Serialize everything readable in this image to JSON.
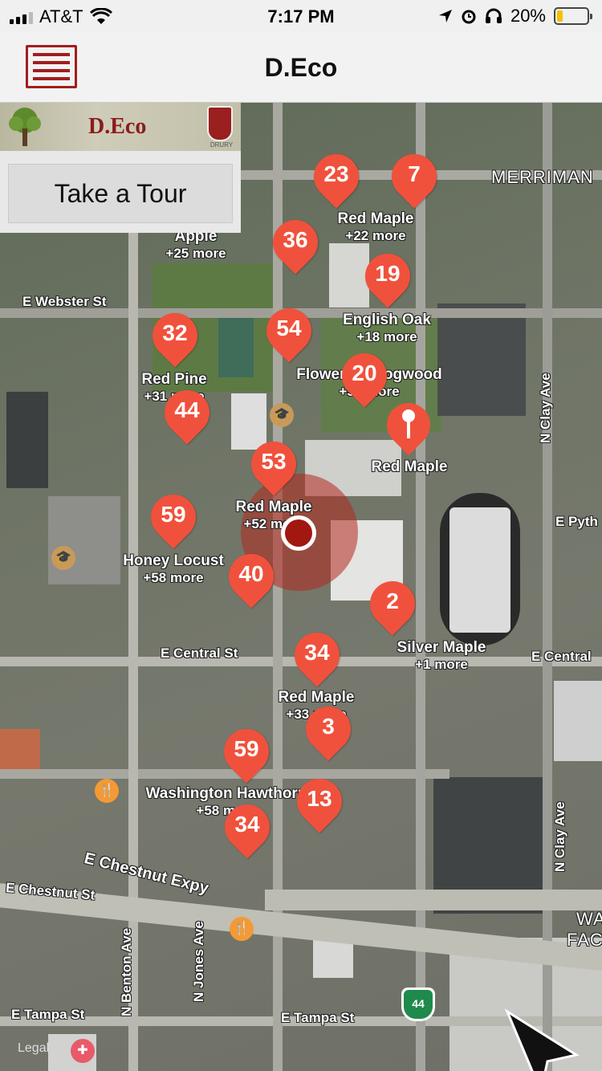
{
  "status_bar": {
    "carrier": "AT&T",
    "time": "7:17 PM",
    "battery_percent": "20%",
    "battery_level": 0.2,
    "icons": [
      "signal-icon",
      "wifi-icon",
      "location-arrow-icon",
      "alarm-icon",
      "headphones-icon",
      "battery-icon"
    ]
  },
  "nav": {
    "title": "D.Eco",
    "menu_icon": "hamburger-menu-icon"
  },
  "brand": {
    "name": "D.Eco",
    "crest_caption": "DRURY"
  },
  "tour": {
    "button_label": "Take a Tour"
  },
  "map": {
    "streets": {
      "merriman": "MERRIMAN",
      "webster": "E Webster St",
      "clay_north": "N Clay Ave",
      "clay_south": "N Clay Ave",
      "pythian": "E Pyth",
      "central_west": "E Central St",
      "central_east": "E Central",
      "chestnut_expy": "E Chestnut Expy",
      "chestnut_st": "E Chestnut St",
      "benton": "N Benton Ave",
      "jones": "N Jones Ave",
      "tampa_west": "E Tampa St",
      "tampa_east": "E Tampa St",
      "wa_fa_1": "WA",
      "wa_fa_2": "FAC"
    },
    "clusters": [
      {
        "count": "23"
      },
      {
        "count": "7"
      },
      {
        "count": "36"
      },
      {
        "count": "19"
      },
      {
        "count": "54"
      },
      {
        "count": "32"
      },
      {
        "count": "20"
      },
      {
        "count": "44"
      },
      {
        "count": "53"
      },
      {
        "count": "59"
      },
      {
        "count": "40"
      },
      {
        "count": "2"
      },
      {
        "count": "34"
      },
      {
        "count": "3"
      },
      {
        "count": "59"
      },
      {
        "count": "13"
      },
      {
        "count": "34"
      }
    ],
    "labels": [
      {
        "name": "Red Maple",
        "more": "+22 more"
      },
      {
        "name": "Apple",
        "more": "+25 more"
      },
      {
        "name": "English Oak",
        "more": "+18 more"
      },
      {
        "name": "Red Pine",
        "more": "+31 more"
      },
      {
        "name": "Flowering Dogwood",
        "more": "+53 more"
      },
      {
        "name": "Red Maple",
        "more": ""
      },
      {
        "name": "Red Maple",
        "more": "+52 more"
      },
      {
        "name": "Honey Locust",
        "more": "+58 more"
      },
      {
        "name": "Silver Maple",
        "more": "+1 more"
      },
      {
        "name": "Red Maple",
        "more": "+33 more"
      },
      {
        "name": "Washington Hawthorn",
        "more": "+58 more"
      }
    ],
    "highway_shield": "44",
    "legal": "Legal",
    "colors": {
      "pin": "#f0513c",
      "user_location": "#a01810",
      "brand_red": "#a01e1e"
    }
  }
}
